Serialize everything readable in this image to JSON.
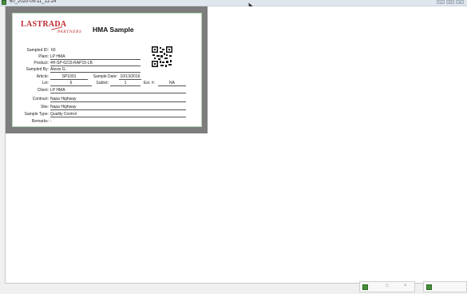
{
  "window": {
    "title": "60_2020-09-11_11-24"
  },
  "card": {
    "logo_main": "LASTRADA",
    "logo_sub": "PARTNERS",
    "title": "HMA Sample",
    "fields": {
      "sampled_id": {
        "label": "Sampled ID:",
        "value": "60"
      },
      "plant": {
        "label": "Plant:",
        "value": "LP HMA"
      },
      "product": {
        "label": "Product:",
        "value": "4H-SP-0215-RAP15-LB"
      },
      "sampled_by": {
        "label": "Sampled By:",
        "value": "Alexis G."
      },
      "article": {
        "label": "Article:",
        "value": "SP1001"
      },
      "sample_date": {
        "label": "Sample Date:",
        "value": "10/13/2016"
      },
      "lot": {
        "label": "Lot:",
        "value": "6"
      },
      "sublot": {
        "label": "Sublot:",
        "value": "1"
      },
      "ext": {
        "label": "Ext. #:",
        "value": "NA"
      },
      "client": {
        "label": "Client:",
        "value": "LP HMA"
      },
      "contract": {
        "label": "Contract:",
        "value": "Napa Highway"
      },
      "site": {
        "label": "Site:",
        "value": "Napa Highway"
      },
      "sample_type": {
        "label": "Sample Type:",
        "value": "Quality Control"
      },
      "remarks": {
        "label": "Remarks:",
        "value": "-"
      }
    }
  },
  "icons": {
    "qr": "qr-code-icon",
    "app": "app-icon"
  }
}
